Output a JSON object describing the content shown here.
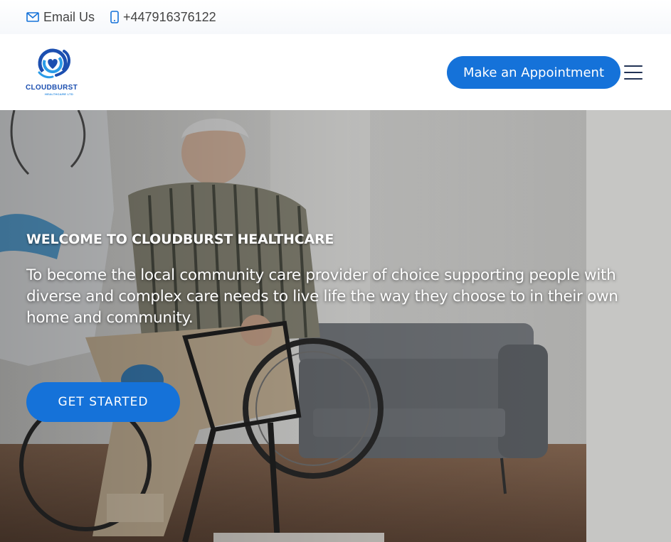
{
  "topbar": {
    "email_label": "Email Us",
    "email_icon": "envelope-icon",
    "phone_label": "+447916376122",
    "phone_icon": "mobile-phone-icon"
  },
  "header": {
    "logo_text": "CLOUDBURST",
    "logo_subtext": "HEALTHCARE LTD",
    "appointment_label": "Make an Appointment",
    "menu_icon": "hamburger-menu-icon"
  },
  "hero": {
    "eyebrow": "WELCOME TO CLOUDBURST HEALTHCARE",
    "text": "To become the local community care provider of choice supporting people with diverse and complex care needs to live life the way they choose to in their own home and community.",
    "cta_label": "GET STARTED",
    "image": "photo-caregiver-with-elderly-man-in-wheelchair"
  },
  "colors": {
    "primary": "#1572d9",
    "logo_blue": "#1c4fb0",
    "text_dark": "#444444"
  }
}
